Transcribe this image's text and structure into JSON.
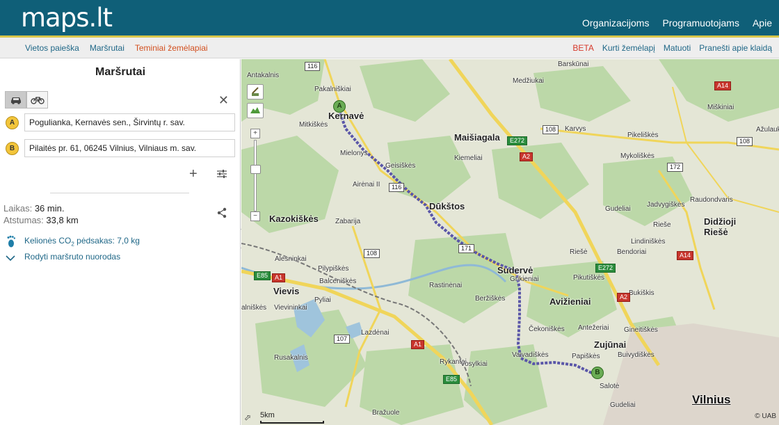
{
  "header": {
    "logo": "maps.lt",
    "nav": [
      "Organizacijoms",
      "Programuotojams",
      "Apie"
    ]
  },
  "subnav": {
    "left": [
      "Vietos paieška",
      "Maršrutai",
      "Teminiai žemėlapiai"
    ],
    "beta": "BETA",
    "right": [
      "Kurti žemėlapį",
      "Matuoti",
      "Pranešti apie klaidą"
    ]
  },
  "sidebar": {
    "title": "Maršrutai",
    "waypoints": [
      {
        "label": "A",
        "value": "Pogulianka, Kernavės sen., Širvintų r. sav."
      },
      {
        "label": "B",
        "value": "Pilaitės pr. 61, 06245 Vilnius, Vilniaus m. sav."
      }
    ],
    "add": "+",
    "close": "✕",
    "time_label": "Laikas:",
    "time_value": "36 min.",
    "distance_label": "Atstumas:",
    "distance_value": "33,8 km",
    "co2_prefix": "Kelionės CO",
    "co2_sub": "2",
    "co2_suffix": " pėdsakas: 7,0 kg",
    "directions": "Rodyti maršruto nuorodas",
    "collapse": "◀"
  },
  "map": {
    "places": [
      {
        "t": "Antakalnis",
        "c": ""
      },
      {
        "t": "Pakalniškiai",
        "c": ""
      },
      {
        "t": "Kernavė",
        "c": "big"
      },
      {
        "t": "Mitkiškės",
        "c": ""
      },
      {
        "t": "Mielonys",
        "c": ""
      },
      {
        "t": "Geisiškės",
        "c": ""
      },
      {
        "t": "Airėnai II",
        "c": ""
      },
      {
        "t": "Maišiagala",
        "c": "big"
      },
      {
        "t": "Kiemeliai",
        "c": ""
      },
      {
        "t": "Dūkštos",
        "c": "big"
      },
      {
        "t": "Kazokiškės",
        "c": "big"
      },
      {
        "t": "Zabarija",
        "c": ""
      },
      {
        "t": "Barskūnai",
        "c": ""
      },
      {
        "t": "Medžiukai",
        "c": ""
      },
      {
        "t": "Karvys",
        "c": ""
      },
      {
        "t": "Miškiniai",
        "c": ""
      },
      {
        "t": "Pikeliškės",
        "c": ""
      },
      {
        "t": "Mykoliškės",
        "c": ""
      },
      {
        "t": "Ažulaukė",
        "c": ""
      },
      {
        "t": "Gudeliai",
        "c": ""
      },
      {
        "t": "Jadvygiškės",
        "c": ""
      },
      {
        "t": "Raudondvaris",
        "c": ""
      },
      {
        "t": "Rieše",
        "c": ""
      },
      {
        "t": "Didžioji",
        "c": "big"
      },
      {
        "t": "Riešė",
        "c": "big"
      },
      {
        "t": "Lindiniškės",
        "c": ""
      },
      {
        "t": "Bendoriai",
        "c": ""
      },
      {
        "t": "Riešė",
        "c": ""
      },
      {
        "t": "Alesninkai",
        "c": ""
      },
      {
        "t": "Pilypiškės",
        "c": ""
      },
      {
        "t": "Balceniškės",
        "c": ""
      },
      {
        "t": "Vievis",
        "c": "big"
      },
      {
        "t": "Pyliai",
        "c": ""
      },
      {
        "t": "Vievininkai",
        "c": ""
      },
      {
        "t": "Sudervė",
        "c": "big"
      },
      {
        "t": "Grikieniai",
        "c": ""
      },
      {
        "t": "Pikutiškės",
        "c": ""
      },
      {
        "t": "Bukiškis",
        "c": ""
      },
      {
        "t": "Rastinėnai",
        "c": ""
      },
      {
        "t": "Beržiškės",
        "c": ""
      },
      {
        "t": "Avižieniai",
        "c": "big"
      },
      {
        "t": "Lazdėnai",
        "c": ""
      },
      {
        "t": "Čekoniškės",
        "c": ""
      },
      {
        "t": "Antežeriai",
        "c": ""
      },
      {
        "t": "Gineitiškės",
        "c": ""
      },
      {
        "t": "Zujūnai",
        "c": "big"
      },
      {
        "t": "Buivydiškės",
        "c": ""
      },
      {
        "t": "Vaivadiškės",
        "c": ""
      },
      {
        "t": "Papiškės",
        "c": ""
      },
      {
        "t": "Rusakalnis",
        "c": ""
      },
      {
        "t": "Rykantai",
        "c": ""
      },
      {
        "t": "Vosylkiai",
        "c": ""
      },
      {
        "t": "Salotė",
        "c": ""
      },
      {
        "t": "Bražuole",
        "c": ""
      },
      {
        "t": "Gudeliai",
        "c": ""
      },
      {
        "t": "Vilnius",
        "c": "city"
      },
      {
        "t": "alniškės",
        "c": ""
      }
    ],
    "shields": [
      {
        "t": "116",
        "c": ""
      },
      {
        "t": "116",
        "c": ""
      },
      {
        "t": "108",
        "c": ""
      },
      {
        "t": "108",
        "c": ""
      },
      {
        "t": "108",
        "c": ""
      },
      {
        "t": "172",
        "c": ""
      },
      {
        "t": "171",
        "c": ""
      },
      {
        "t": "107",
        "c": ""
      },
      {
        "t": "E272",
        "c": "e"
      },
      {
        "t": "E272",
        "c": "e"
      },
      {
        "t": "E85",
        "c": "e"
      },
      {
        "t": "E85",
        "c": "e"
      },
      {
        "t": "A2",
        "c": "a"
      },
      {
        "t": "A2",
        "c": "a"
      },
      {
        "t": "A14",
        "c": "a"
      },
      {
        "t": "A14",
        "c": "a"
      },
      {
        "t": "A1",
        "c": "a"
      },
      {
        "t": "A1",
        "c": "a"
      }
    ],
    "pin_a": "A",
    "pin_b": "B",
    "scale_label": "5km",
    "copyright": "© UAB",
    "zoom_in": "+",
    "zoom_out": "−",
    "zoom_level": 0.4
  },
  "colors": {
    "header": "#0f5f78",
    "accent": "#d8c64a",
    "active_tab": "#d25020",
    "route": "#5a56a8"
  }
}
